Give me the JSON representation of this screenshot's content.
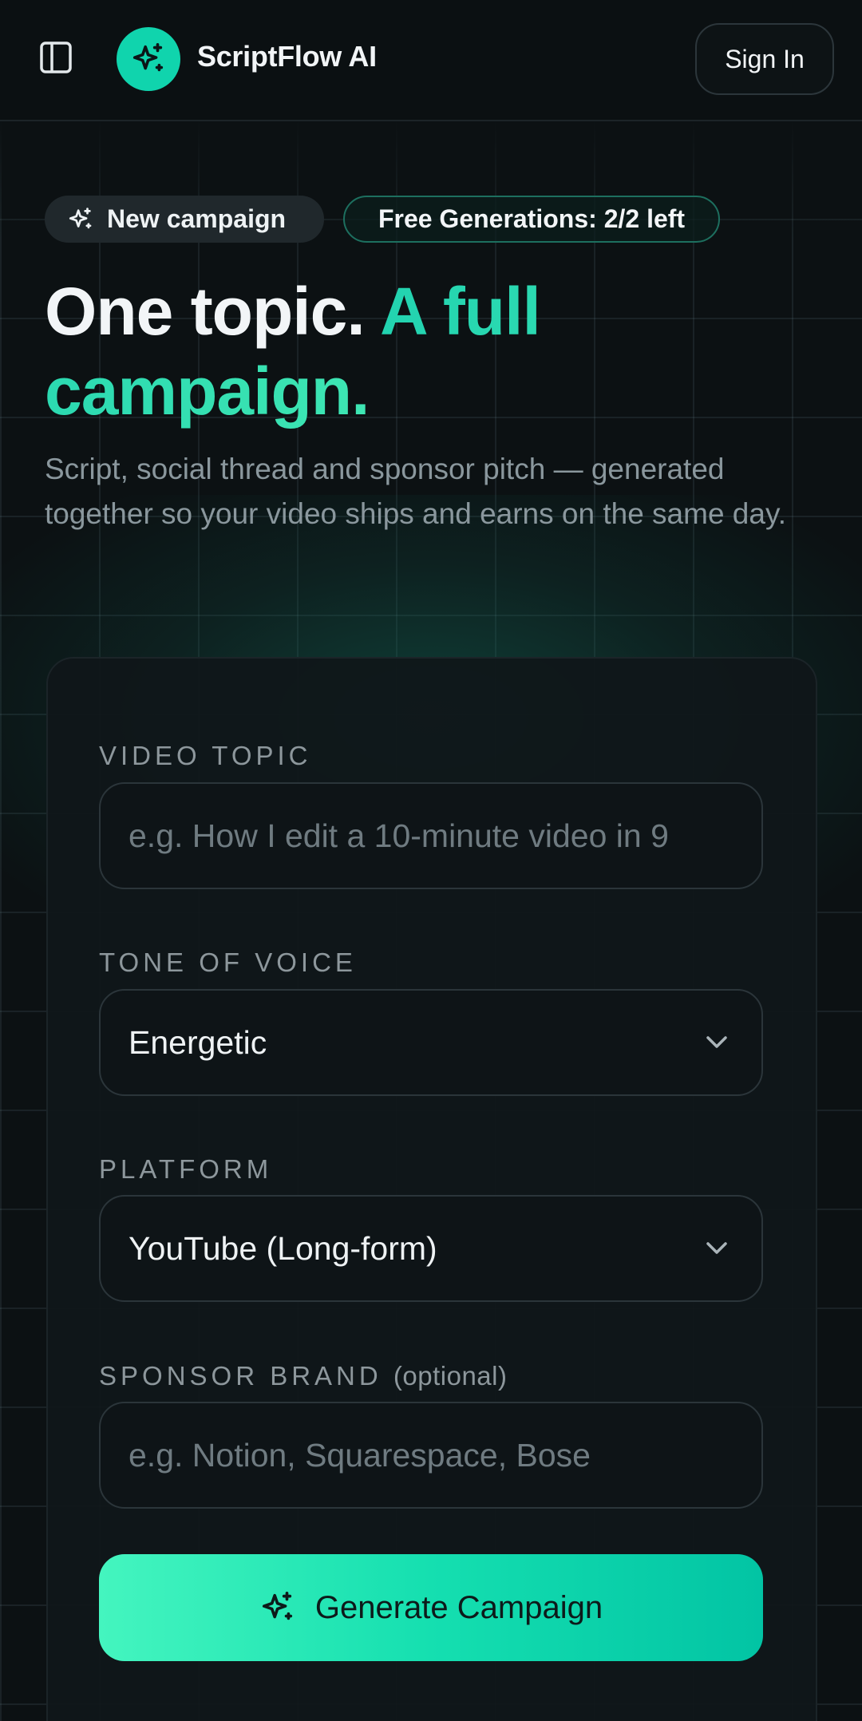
{
  "header": {
    "app_title": "ScriptFlow AI",
    "sign_in_label": "Sign In"
  },
  "hero": {
    "chip_new": "New campaign",
    "chip_free": "Free Generations: 2/2 left",
    "title_part1": "One topic.",
    "title_part2": "A full campaign.",
    "subtitle": "Script, social thread and sponsor pitch — generated together so your video ships and earns on the same day."
  },
  "form": {
    "topic": {
      "label": "VIDEO TOPIC",
      "placeholder": "e.g. How I edit a 10-minute video in 9"
    },
    "tone": {
      "label": "TONE OF VOICE",
      "value": "Energetic"
    },
    "platform": {
      "label": "PLATFORM",
      "value": "YouTube (Long-form)"
    },
    "sponsor": {
      "label": "SPONSOR BRAND",
      "optional": "(optional)",
      "placeholder": "e.g. Notion, Squarespace, Bose"
    },
    "generate_label": "Generate Campaign"
  },
  "colors": {
    "accent": "#10d4ad",
    "background": "#0c1113",
    "button_gradient_start": "#44f5bf",
    "button_gradient_end": "#02c4a4"
  },
  "icons": {
    "sidebar": "sidebar-toggle-icon",
    "logo": "sparkles-icon",
    "chip": "sparkles-icon",
    "select": "chevron-down-icon",
    "generate": "sparkles-icon"
  }
}
